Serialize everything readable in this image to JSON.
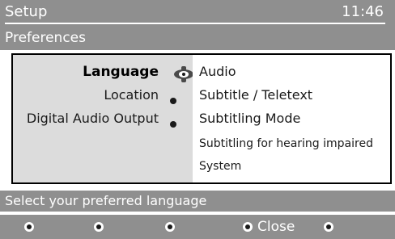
{
  "header": {
    "title": "Setup",
    "clock": "11:46",
    "subtitle": "Preferences"
  },
  "menu": {
    "items": [
      {
        "label": "Language",
        "active": true
      },
      {
        "label": "Location",
        "active": false
      },
      {
        "label": "Digital Audio Output",
        "active": false
      }
    ]
  },
  "options": {
    "items": [
      {
        "label": "Audio"
      },
      {
        "label": "Subtitle / Teletext"
      },
      {
        "label": "Subtitling Mode"
      },
      {
        "label": "Subtitling for hearing impaired"
      },
      {
        "label": "System"
      }
    ]
  },
  "hint": {
    "text": "Select your preferred language"
  },
  "footer": {
    "close_label": "Close"
  },
  "colors": {
    "bar": "#8f8f8f",
    "panel_left": "#dcdcdc",
    "panel_right": "#ffffff",
    "text_light": "#ffffff"
  },
  "icons": {
    "selector": "navigation-cursor-icon",
    "bullet": "bullet-icon",
    "key": "remote-key-icon"
  }
}
